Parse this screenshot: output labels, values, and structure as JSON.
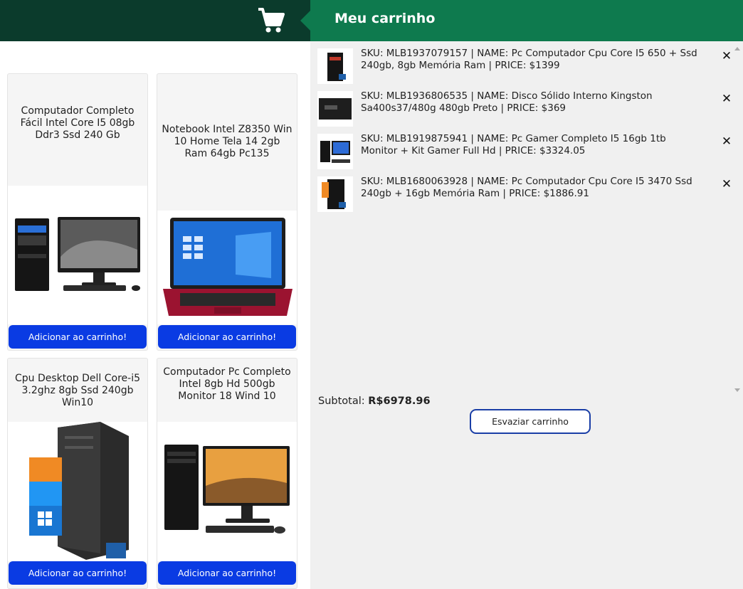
{
  "header": {
    "cart_icon": "shopping-cart-icon",
    "cart_title": "Meu carrinho",
    "colors": {
      "left_bar": "#0b3b2c",
      "right_bar": "#0e7a4e",
      "button_blue": "#0a3be3"
    }
  },
  "products": [
    {
      "title": "Computador Completo Fácil Intel Core I5 08gb Ddr3 Ssd 240 Gb",
      "button": "Adicionar ao carrinho!",
      "image": "desktop-pc-monitor-image"
    },
    {
      "title": "Notebook Intel Z8350 Win 10 Home Tela 14 2gb Ram 64gb Pc135",
      "button": "Adicionar ao carrinho!",
      "image": "red-laptop-image"
    },
    {
      "title": "Cpu Desktop Dell Core-i5 3.2ghz 8gb Ssd 240gb Win10",
      "button": "Adicionar ao carrinho!",
      "image": "dell-tower-image"
    },
    {
      "title": "Computador Pc Completo Intel 8gb Hd 500gb Monitor 18 Wind 10",
      "button": "Adicionar ao carrinho!",
      "image": "pc-monitor-image"
    }
  ],
  "cart": {
    "items": [
      {
        "line1": "SKU: MLB1937079157 | NAME: Pc Computador Cpu Core I5 650 + Ssd",
        "line2": "240gb, 8gb Memória Ram | PRICE: $1399",
        "remove": "✕"
      },
      {
        "line1": "SKU: MLB1936806535 | NAME: Disco Sólido Interno Kingston",
        "line2": "Sa400s37/480g 480gb Preto | PRICE: $369",
        "remove": "✕"
      },
      {
        "line1": "SKU: MLB1919875941 | NAME: Pc Gamer Completo I5 16gb 1tb",
        "line2": "Monitor + Kit Gamer Full Hd | PRICE: $3324.05",
        "remove": "✕"
      },
      {
        "line1": "SKU: MLB1680063928 | NAME: Pc Computador Cpu Core I5 3470 Ssd",
        "line2": "240gb + 16gb Memória Ram | PRICE: $1886.91",
        "remove": "✕"
      }
    ],
    "subtotal_label": "Subtotal:",
    "subtotal_value": "R$6978.96",
    "empty_button": "Esvaziar carrinho"
  }
}
